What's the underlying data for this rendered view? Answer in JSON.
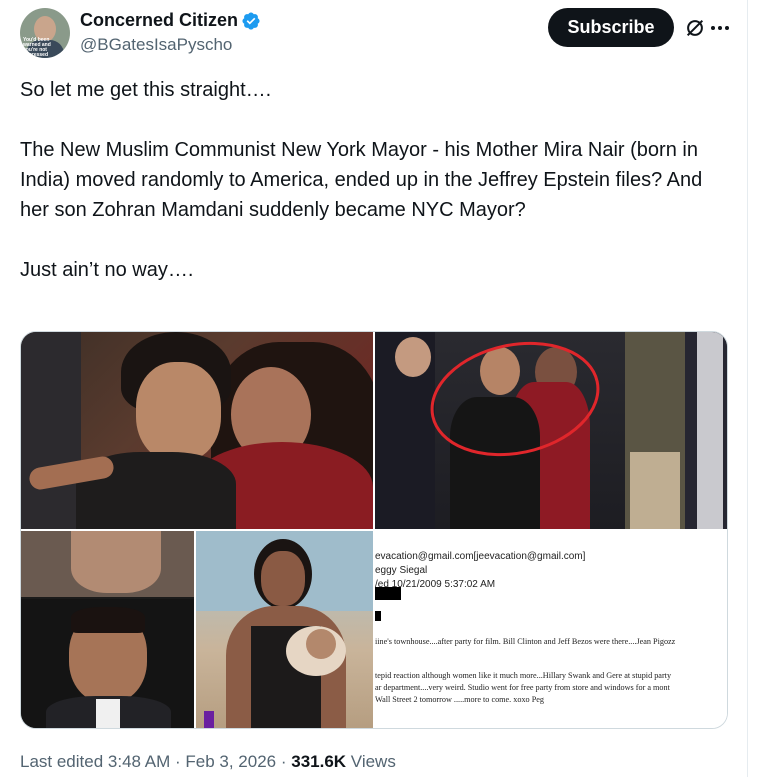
{
  "header": {
    "display_name": "Concerned Citizen",
    "handle": "@BGatesIsaPyscho",
    "subscribe_label": "Subscribe",
    "avatar_caption": "You'd been warned and you're not impressed"
  },
  "tweet": {
    "paragraphs": [
      "So let me get this straight….",
      "The New Muslim Communist New York Mayor - his Mother Mira Nair (born in India) moved randomly to America, ended up in the Jeffrey Epstein files?  And her son Zohran Mamdani suddenly became NYC Mayor?",
      "Just ain’t no way…."
    ]
  },
  "document_image": {
    "lines": [
      "evacation@gmail.com[jeevacation@gmail.com]",
      "eggy Siegal",
      "/ed 10/21/2009 5:37:02 AM",
      "iine's townhouse....after party for film.  Bill Clinton and Jeff Bezos were there....Jean Pigozz",
      "tepid reaction although women like it much more...Hillary Swank and Gere at stupid party",
      "ar department....very weird.  Studio went for free party from store and windows for a mont",
      " Wall Street 2 tomorrow .....more to come. xoxo Peg"
    ]
  },
  "footer": {
    "prefix": "Last edited 3:48 AM · Feb 3, 2026 · ",
    "views_count": "331.6K",
    "views_label": " Views"
  },
  "colors": {
    "verified_blue": "#1d9bf0",
    "text_primary": "#0f1419",
    "text_secondary": "#536471",
    "circle_annotation": "#e0262b"
  }
}
